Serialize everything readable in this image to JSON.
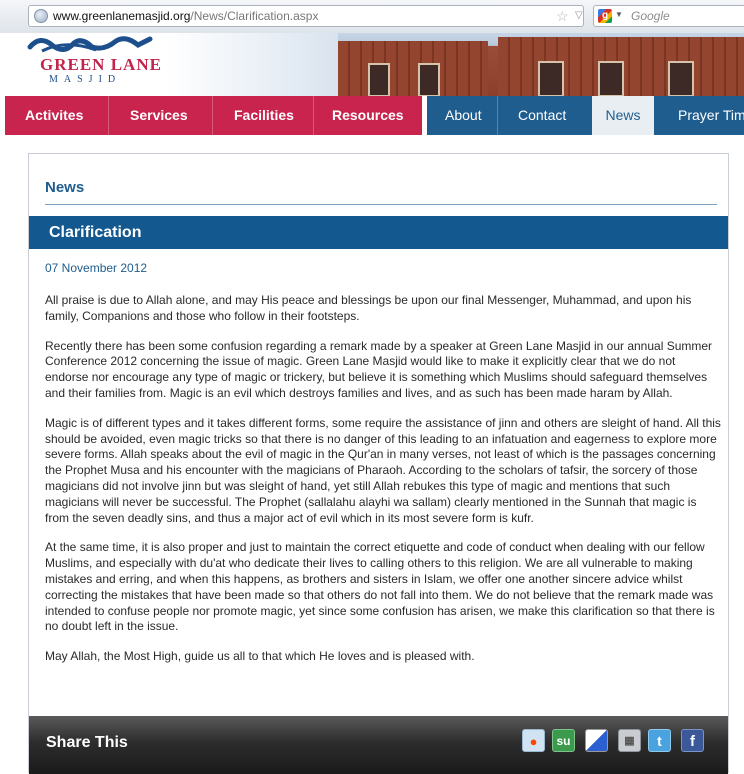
{
  "browser": {
    "url_host": "www.greenlanemasjid.org",
    "url_path": "/News/Clarification.aspx",
    "search_placeholder": "Google"
  },
  "site": {
    "logo_name": "GREEN LANE",
    "logo_sub": "MASJID"
  },
  "nav": {
    "primary": [
      "Activites",
      "Services",
      "Facilities",
      "Resources"
    ],
    "secondary": [
      "About",
      "Contact",
      "News",
      "Prayer Tim"
    ],
    "active": "News"
  },
  "main": {
    "section_heading": "News",
    "article_title": "Clarification",
    "date": "07 November 2012",
    "paragraphs": [
      "All praise is due to Allah alone, and may His peace and blessings be upon our final Messenger, Muhammad, and upon his family, Companions and those who follow in their footsteps.",
      "Recently there has been some confusion regarding a remark made by a speaker at Green Lane Masjid in our annual Summer Conference 2012 concerning the issue of magic. Green Lane Masjid would like to make it explicitly clear that we do not endorse nor encourage any type of magic or trickery, but believe it is something which Muslims should safeguard themselves and their families from. Magic is an evil which destroys families and lives, and as such has been made haram by Allah.",
      "Magic is of different types and it takes different forms, some require the assistance of jinn and others are sleight of hand. All this should be avoided, even magic tricks so that there is no danger of this leading to an infatuation and eagerness to explore more severe forms. Allah speaks about the evil of magic in the Qur'an in many verses, not least of which is the passages concerning the Prophet Musa and his encounter with the magicians of Pharaoh. According to the scholars of tafsir, the sorcery of those magicians did not involve jinn but was sleight of hand, yet still Allah rebukes this type of magic and mentions that such magicians will never be successful. The Prophet (sallalahu alayhi wa sallam) clearly mentioned in the Sunnah that magic is from the seven deadly sins, and thus a major act of evil which in its most severe form is kufr.",
      "At the same time, it is also proper and just to maintain the correct etiquette and code of conduct when dealing with our fellow Muslims, and especially with du'at who dedicate their lives to calling others to this religion. We are all vulnerable to making mistakes and erring, and when this happens, as brothers and sisters in Islam, we offer one another sincere advice whilst correcting the mistakes that have been made so that others do not fall into them. We do not believe that the remark made was intended to confuse people nor promote magic, yet since some confusion has arisen, we make this clarification so that there is no doubt left in the issue.",
      "May Allah, the Most High, guide us all to that which He loves and is pleased with."
    ],
    "share_label": "Share This",
    "share_icons": [
      "reddit-icon",
      "stumbleupon-icon",
      "delicious-icon",
      "digg-icon",
      "twitter-icon",
      "facebook-icon"
    ]
  },
  "colors": {
    "nav_primary": "#c8244e",
    "nav_secondary": "#1f5d8f",
    "title_bar": "#13598f",
    "heading_text": "#1f5d8f"
  }
}
